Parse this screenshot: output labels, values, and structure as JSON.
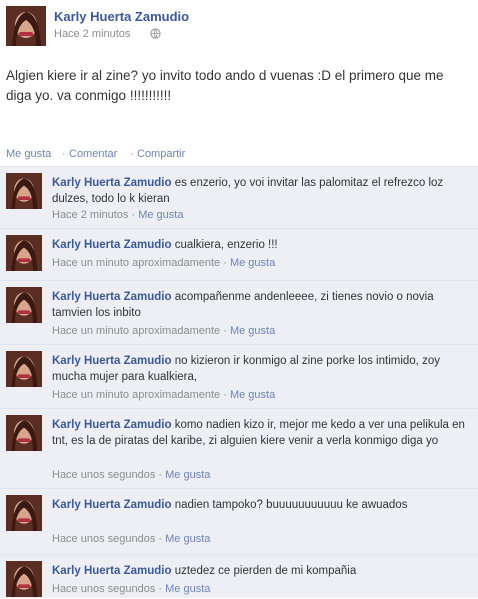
{
  "post": {
    "author": "Karly Huerta Zamudio",
    "time": "Hace 2 minutos",
    "text": "Algien kiere ir al zine? yo invito todo ando d vuenas :D el primero que me diga yo. va conmigo !!!!!!!!!!!",
    "actions": [
      "Me gusta",
      "Comentar",
      "Compartir"
    ]
  },
  "comments": [
    {
      "author": "Karly Huerta Zamudio",
      "text": "es enzerio, yo voi invitar las palomitaz el refrezco loz dulzes, todo lo k kieran",
      "time": "Hace 2 minutos",
      "like": "Me gusta"
    },
    {
      "author": "Karly Huerta Zamudio",
      "text": "cualkiera, enzerio !!!",
      "time": "Hace un minuto aproximadamente",
      "like": "Me gusta"
    },
    {
      "author": "Karly Huerta Zamudio",
      "text": "acompañenme andenleeee, zi tienes novio o novia tamvien los inbito",
      "time": "Hace un minuto aproximadamente",
      "like": "Me gusta"
    },
    {
      "author": "Karly Huerta Zamudio",
      "text": "no kizieron ir konmigo al zine porke los intimido, zoy mucha mujer para kualkiera,",
      "time": "Hace un minuto aproximadamente",
      "like": "Me gusta"
    },
    {
      "author": "Karly Huerta Zamudio",
      "text": "komo nadien kizo ir, mejor me kedo a ver una pelikula en tnt, es la de piratas del karibe, zi alguien kiere venir a verla konmigo diga yo",
      "time": "Hace unos segundos",
      "like": "Me gusta"
    },
    {
      "author": "Karly Huerta Zamudio",
      "text": "nadien tampoko? buuuuuuuuuuu ke awuados",
      "time": "Hace unos segundos",
      "like": "Me gusta"
    },
    {
      "author": "Karly Huerta Zamudio",
      "text": "uztedez ce pierden de mi kompañia",
      "time": "Hace unos segundos",
      "like": "Me gusta"
    }
  ]
}
